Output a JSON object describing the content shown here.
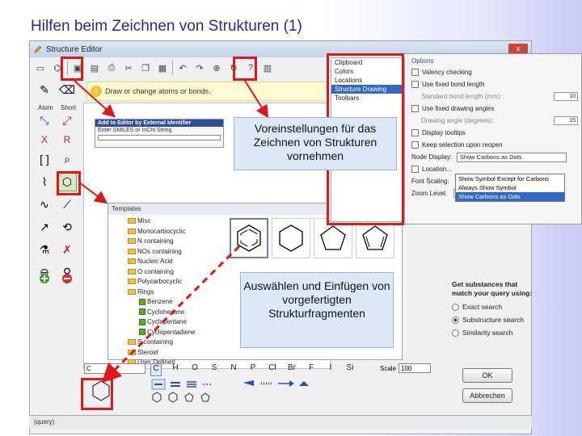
{
  "slide": {
    "title": "Hilfen beim Zeichnen von Strukturen (1)"
  },
  "window": {
    "title": "Structure Editor",
    "close_label": "x"
  },
  "left_tools": {
    "atom_label": "Atom",
    "short_label": "Short",
    "x_label": "X",
    "r_label": "R"
  },
  "info_bar": {
    "text": "Draw or change atoms or bonds."
  },
  "external_panel": {
    "title": "Add to Editor by External Identifier",
    "hint": "Enter SMILES or InChI String"
  },
  "templates": {
    "title": "Templates",
    "tree": [
      {
        "label": "Misc",
        "type": "folder"
      },
      {
        "label": "Monocarbocyclic",
        "type": "folder"
      },
      {
        "label": "N containing",
        "type": "folder"
      },
      {
        "label": "NOs containing",
        "type": "folder"
      },
      {
        "label": "Nucleic Acid",
        "type": "folder"
      },
      {
        "label": "O containing",
        "type": "folder"
      },
      {
        "label": "Polycarbocyclic",
        "type": "folder"
      },
      {
        "label": "Rings",
        "type": "folder"
      },
      {
        "label": "Benzene",
        "type": "check"
      },
      {
        "label": "Cyclohexane",
        "type": "check"
      },
      {
        "label": "Cyclopentane",
        "type": "check"
      },
      {
        "label": "Cyclopentadiene",
        "type": "check"
      },
      {
        "label": "S containing",
        "type": "folder"
      },
      {
        "label": "Steroid",
        "type": "folder"
      },
      {
        "label": "User Defined",
        "type": "folder"
      }
    ]
  },
  "options": {
    "header": "Options",
    "categories": [
      "Clipboard",
      "Colors",
      "Locations",
      "Structure Drawing",
      "Toolbars"
    ],
    "selected_category": "Structure Drawing",
    "rows": [
      {
        "label": "Valency checking",
        "type": "check"
      },
      {
        "label": "Use fixed bond length",
        "type": "check"
      },
      {
        "label": "Standard bond length (mm):",
        "type": "sub",
        "value": "10"
      },
      {
        "label": "Use fixed drawing angles",
        "type": "check"
      },
      {
        "label": "Drawing angle (degrees):",
        "type": "sub",
        "value": "15"
      },
      {
        "label": "Display tooltips",
        "type": "check"
      },
      {
        "label": "Keep selection upon reopen",
        "type": "check"
      }
    ],
    "node_display_label": "Node Display:",
    "node_display_value": "Show Carbons as Dots",
    "dropdown_options": [
      "Show Symbol Except for Carbons",
      "Always Show Symbol",
      "Show Carbons as Dots"
    ],
    "location_label": "Location...",
    "font_scaling_label": "Font Scaling:",
    "zoom_label": "Zoom Level:",
    "zoom_value": "100"
  },
  "search": {
    "title": "Get substances that match your query using:",
    "options": [
      "Exact search",
      "Substructure search",
      "Similarity search"
    ],
    "selected": "Substructure search",
    "ok_label": "OK",
    "cancel_label": "Abbrechen"
  },
  "element_bar": {
    "c_field": "C",
    "elements": [
      "C",
      "H",
      "O",
      "S",
      "N",
      "P",
      "Cl",
      "Br",
      "F",
      "I",
      "Si"
    ],
    "scale_label": "Scale",
    "scale_value": "100"
  },
  "status_bar": {
    "text": "(query)"
  },
  "callouts": {
    "presets": "Voreinstellungen für das Zeichnen von Strukturen vornehmen",
    "fragments": "Auswählen und Einfügen von vorgefertigten Strukturfragmenten"
  },
  "colors": {
    "highlight": "#e01818",
    "callout_bg": "#dbe8f7",
    "title": "#2a2a8c"
  }
}
